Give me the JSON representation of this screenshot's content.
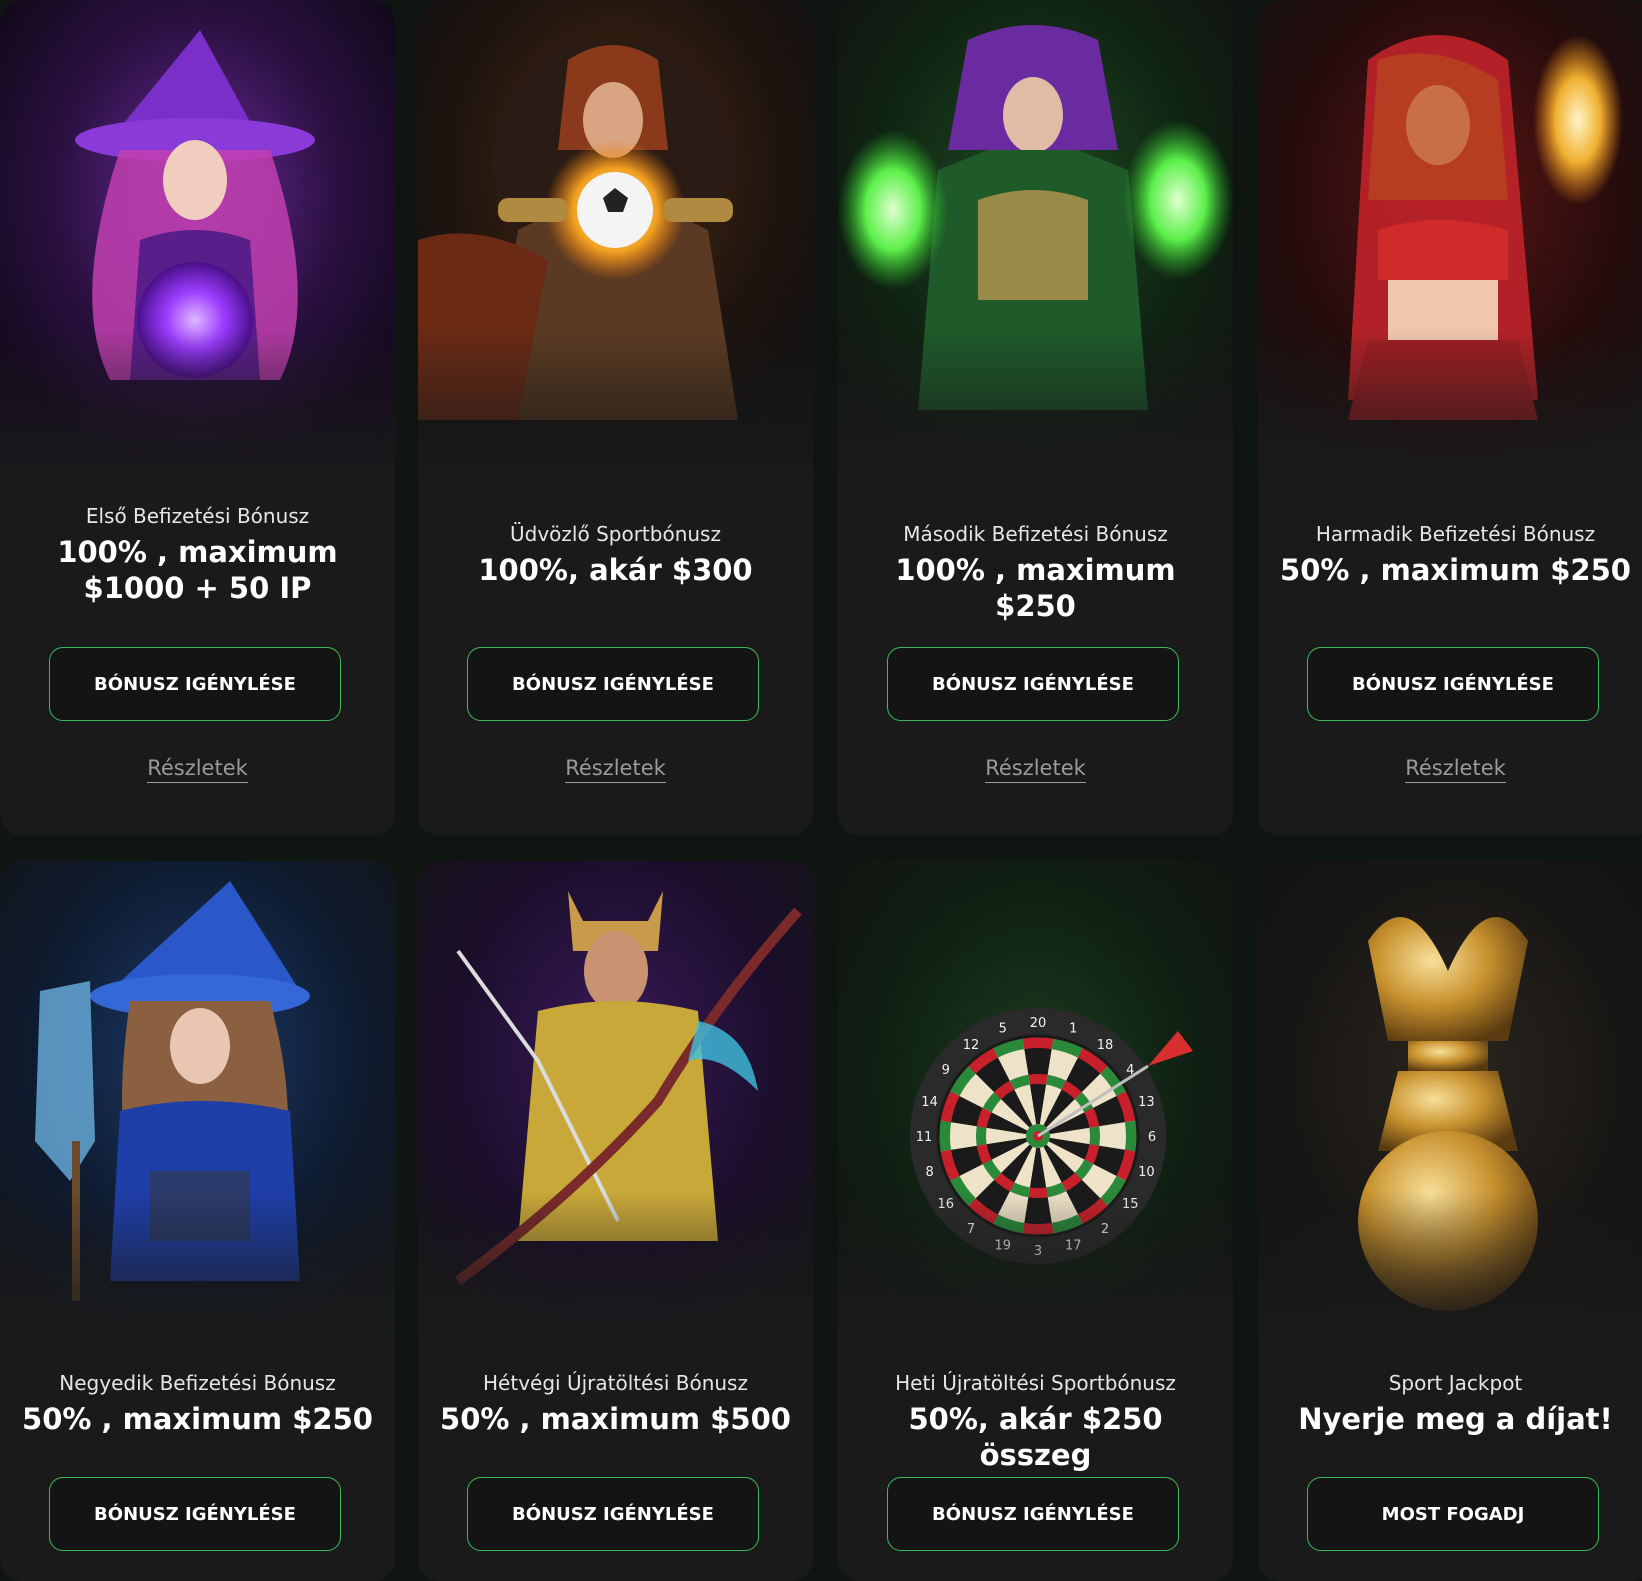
{
  "colors": {
    "card_bg": "#1a1a1a",
    "page_bg": "#0f1612",
    "button_border": "#3dbb5a",
    "details_text": "#9a9a9a"
  },
  "cards": [
    {
      "subtitle": "Első Befizetési Bónusz",
      "headline": "100% , maximum $1000 + 50 IP",
      "button": "BÓNUSZ IGÉNYLÉSE",
      "details": "Részletek",
      "art": "purple-witch-orb-image"
    },
    {
      "subtitle": "Üdvözlő Sportbónusz",
      "headline": "100%, akár $300",
      "button": "BÓNUSZ IGÉNYLÉSE",
      "details": "Részletek",
      "art": "warrior-with-football-image"
    },
    {
      "subtitle": "Második Befizetési Bónusz",
      "headline": "100% , maximum $250",
      "button": "BÓNUSZ IGÉNYLÉSE",
      "details": "Részletek",
      "art": "green-sorceress-image"
    },
    {
      "subtitle": "Harmadik Befizetési Bónusz",
      "headline": "50% , maximum $250",
      "button": "BÓNUSZ IGÉNYLÉSE",
      "details": "Részletek",
      "art": "red-fire-sorceress-image"
    },
    {
      "subtitle": "Negyedik Befizetési Bónusz",
      "headline": "50% , maximum $250",
      "button": "BÓNUSZ IGÉNYLÉSE",
      "details": "",
      "art": "blue-witch-broom-image"
    },
    {
      "subtitle": "Hétvégi Újratöltési Bónusz",
      "headline": "50% , maximum $500",
      "button": "BÓNUSZ IGÉNYLÉSE",
      "details": "",
      "art": "golden-archer-image"
    },
    {
      "subtitle": "Heti Újratöltési Sportbónusz",
      "headline": "50%, akár $250 összeg",
      "button": "BÓNUSZ IGÉNYLÉSE",
      "details": "",
      "art": "dartboard-image"
    },
    {
      "subtitle": "Sport Jackpot",
      "headline": "Nyerje meg a díjat!",
      "button": "MOST FOGADJ",
      "details": "",
      "art": "golden-dragon-trophy-image"
    }
  ],
  "dartboard_numbers": [
    "20",
    "1",
    "18",
    "4",
    "13",
    "6",
    "10",
    "15",
    "2",
    "17",
    "3",
    "19",
    "7",
    "16",
    "8",
    "11",
    "14",
    "9",
    "12",
    "5"
  ]
}
